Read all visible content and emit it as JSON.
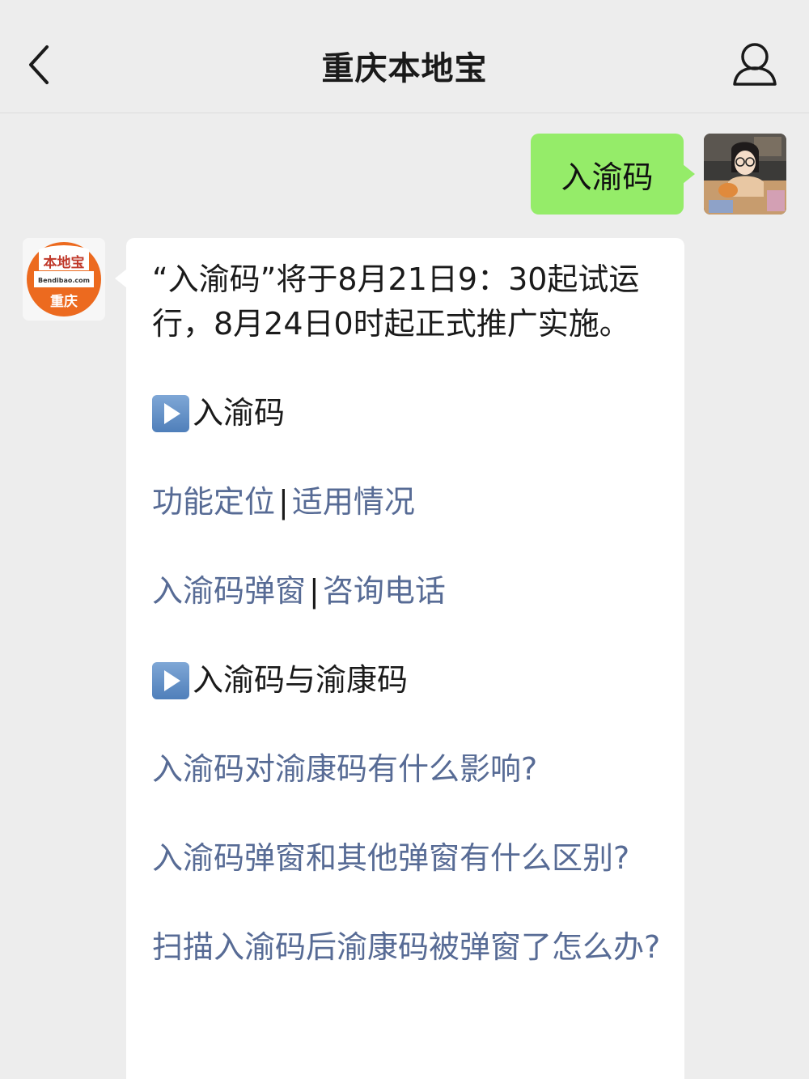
{
  "header": {
    "title": "重庆本地宝"
  },
  "conversation": {
    "outgoing": {
      "text": "入渝码"
    },
    "incoming": {
      "intro": "“入渝码”将于8月21日9：30起试运行，8月24日0时起正式推广实施。",
      "section1": {
        "title": "入渝码",
        "links": [
          {
            "left": "功能定位",
            "separator": "|",
            "right": "适用情况"
          },
          {
            "left": "入渝码弹窗",
            "separator": "|",
            "right": "咨询电话"
          }
        ]
      },
      "section2": {
        "title": "入渝码与渝康码",
        "questions": [
          "入渝码对渝康码有什么影响?",
          "入渝码弹窗和其他弹窗有什么区别?",
          "扫描入渝码后渝康码被弹窗了怎么办?"
        ]
      }
    }
  },
  "logo": {
    "top": "本地宝",
    "middle": "Bendibao.com",
    "bottom": "重庆"
  },
  "colors": {
    "background": "#ededed",
    "outgoing_bubble": "#95ec69",
    "incoming_bubble": "#ffffff",
    "link": "#576b95",
    "logo_orange": "#ec6a1f"
  }
}
